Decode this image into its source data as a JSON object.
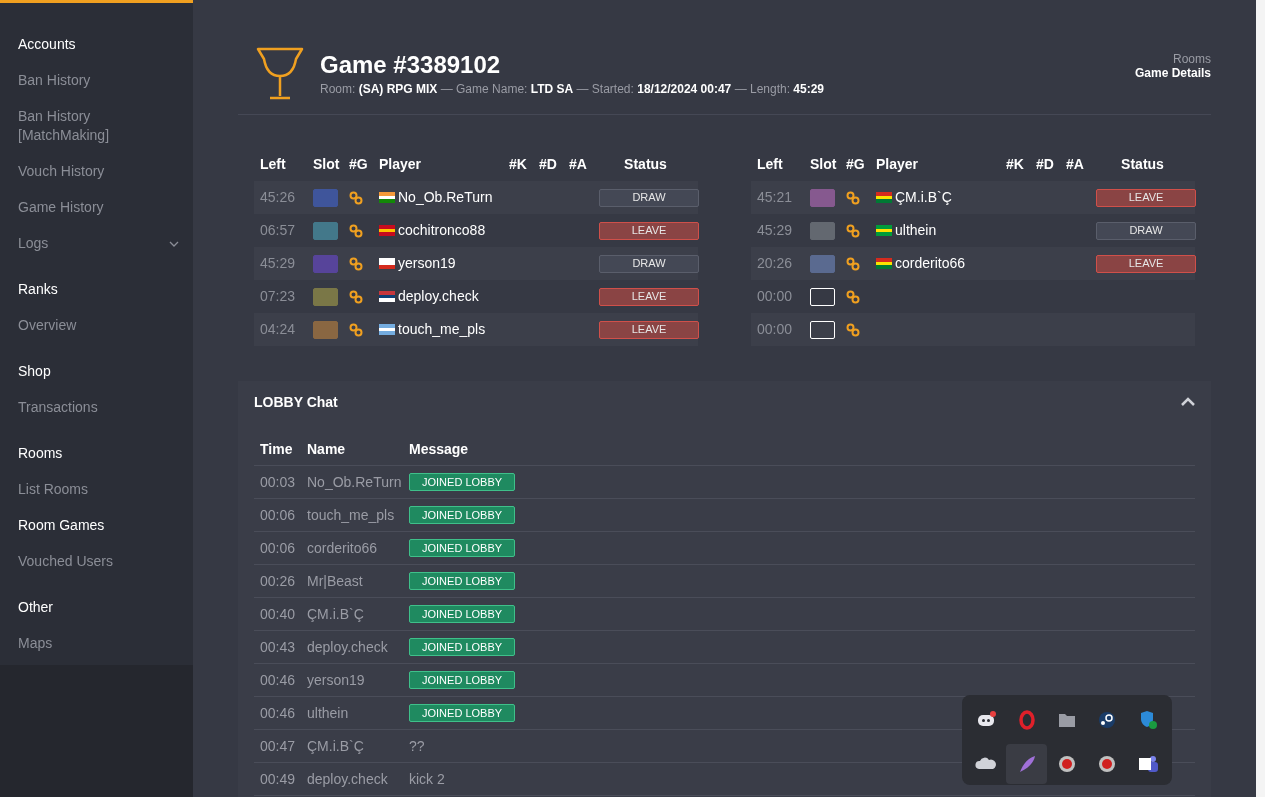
{
  "sidebar": {
    "sections": [
      {
        "title": "Accounts",
        "items": [
          {
            "label": "Ban History",
            "selected": false
          },
          {
            "label": "Ban History [MatchMaking]",
            "selected": false
          },
          {
            "label": "Vouch History",
            "selected": false
          },
          {
            "label": "Game History",
            "selected": false
          },
          {
            "label": "Logs",
            "selected": false,
            "expandable": true
          }
        ]
      },
      {
        "title": "Ranks",
        "items": [
          {
            "label": "Overview",
            "selected": false
          }
        ]
      },
      {
        "title": "Shop",
        "items": [
          {
            "label": "Transactions",
            "selected": false
          }
        ]
      },
      {
        "title": "Rooms",
        "items": [
          {
            "label": "List Rooms",
            "selected": false
          },
          {
            "label": "Room Games",
            "selected": true
          },
          {
            "label": "Vouched Users",
            "selected": false
          }
        ]
      },
      {
        "title": "Other",
        "items": [
          {
            "label": "Maps",
            "selected": false
          }
        ]
      }
    ]
  },
  "header": {
    "title": "Game #3389102",
    "meta": "Room: **(SA) RPG MIX** — Game Name: **LTD SA** — Started: **18/12/2024 00:47** — Length: **45:29**"
  },
  "breadcrumb": [
    "Rooms",
    "Game Details"
  ],
  "teams": [
    {
      "columns": [
        "Left",
        "Slot",
        "#G",
        "Player",
        "#K",
        "#D",
        "#A",
        "Status"
      ],
      "rows": [
        {
          "left": "45:26",
          "color": "#3f559b",
          "player": "No_Ob.ReTurn",
          "status": "DRAW",
          "kind": "draw"
        },
        {
          "left": "06:57",
          "color": "#43788a",
          "player": "cochitronco88",
          "status": "LEAVE",
          "kind": "leave"
        },
        {
          "left": "45:29",
          "color": "#57449a",
          "player": "yerson19",
          "status": "DRAW",
          "kind": "draw"
        },
        {
          "left": "07:23",
          "color": "#7a7747",
          "player": "deploy.check",
          "status": "LEAVE",
          "kind": "leave"
        },
        {
          "left": "04:24",
          "color": "#8a6742",
          "player": "touch_me_pls",
          "status": "LEAVE",
          "kind": "leave"
        }
      ]
    },
    {
      "columns": [
        "Left",
        "Slot",
        "#G",
        "Player",
        "#K",
        "#D",
        "#A",
        "Status"
      ],
      "rows": [
        {
          "left": "45:21",
          "color": "#86598f",
          "player": "ÇM.i.B`Ç",
          "status": "LEAVE",
          "kind": "leave"
        },
        {
          "left": "45:29",
          "color": "#636870",
          "player": "ulthein",
          "status": "DRAW",
          "kind": "draw"
        },
        {
          "left": "20:26",
          "color": "#5a6a90",
          "player": "corderito66",
          "status": "LEAVE",
          "kind": "leave"
        },
        {
          "left": "00:00",
          "kind": "empty"
        },
        {
          "left": "00:00",
          "kind": "empty"
        }
      ]
    }
  ],
  "chat": {
    "title": "LOBBY Chat",
    "expanded": true,
    "columns": [
      "Time",
      "Name",
      "Message"
    ],
    "rows": [
      {
        "time": "00:03",
        "name": "No_Ob.ReTurn",
        "message": "JOINED LOBBY",
        "kind": "event"
      },
      {
        "time": "00:06",
        "name": "touch_me_pls",
        "message": "JOINED LOBBY",
        "kind": "event"
      },
      {
        "time": "00:06",
        "name": "corderito66",
        "message": "JOINED LOBBY",
        "kind": "event"
      },
      {
        "time": "00:26",
        "name": "Mr|Beast",
        "message": "JOINED LOBBY",
        "kind": "event"
      },
      {
        "time": "00:40",
        "name": "ÇM.i.B`Ç",
        "message": "JOINED LOBBY",
        "kind": "event"
      },
      {
        "time": "00:43",
        "name": "deploy.check",
        "message": "JOINED LOBBY",
        "kind": "event"
      },
      {
        "time": "00:46",
        "name": "yerson19",
        "message": "JOINED LOBBY",
        "kind": "event"
      },
      {
        "time": "00:46",
        "name": "ulthein",
        "message": "JOINED LOBBY",
        "kind": "event"
      },
      {
        "time": "00:47",
        "name": "ÇM.i.B`Ç",
        "message": "??",
        "kind": "text"
      },
      {
        "time": "00:49",
        "name": "deploy.check",
        "message": "kick 2",
        "kind": "text"
      }
    ]
  }
}
